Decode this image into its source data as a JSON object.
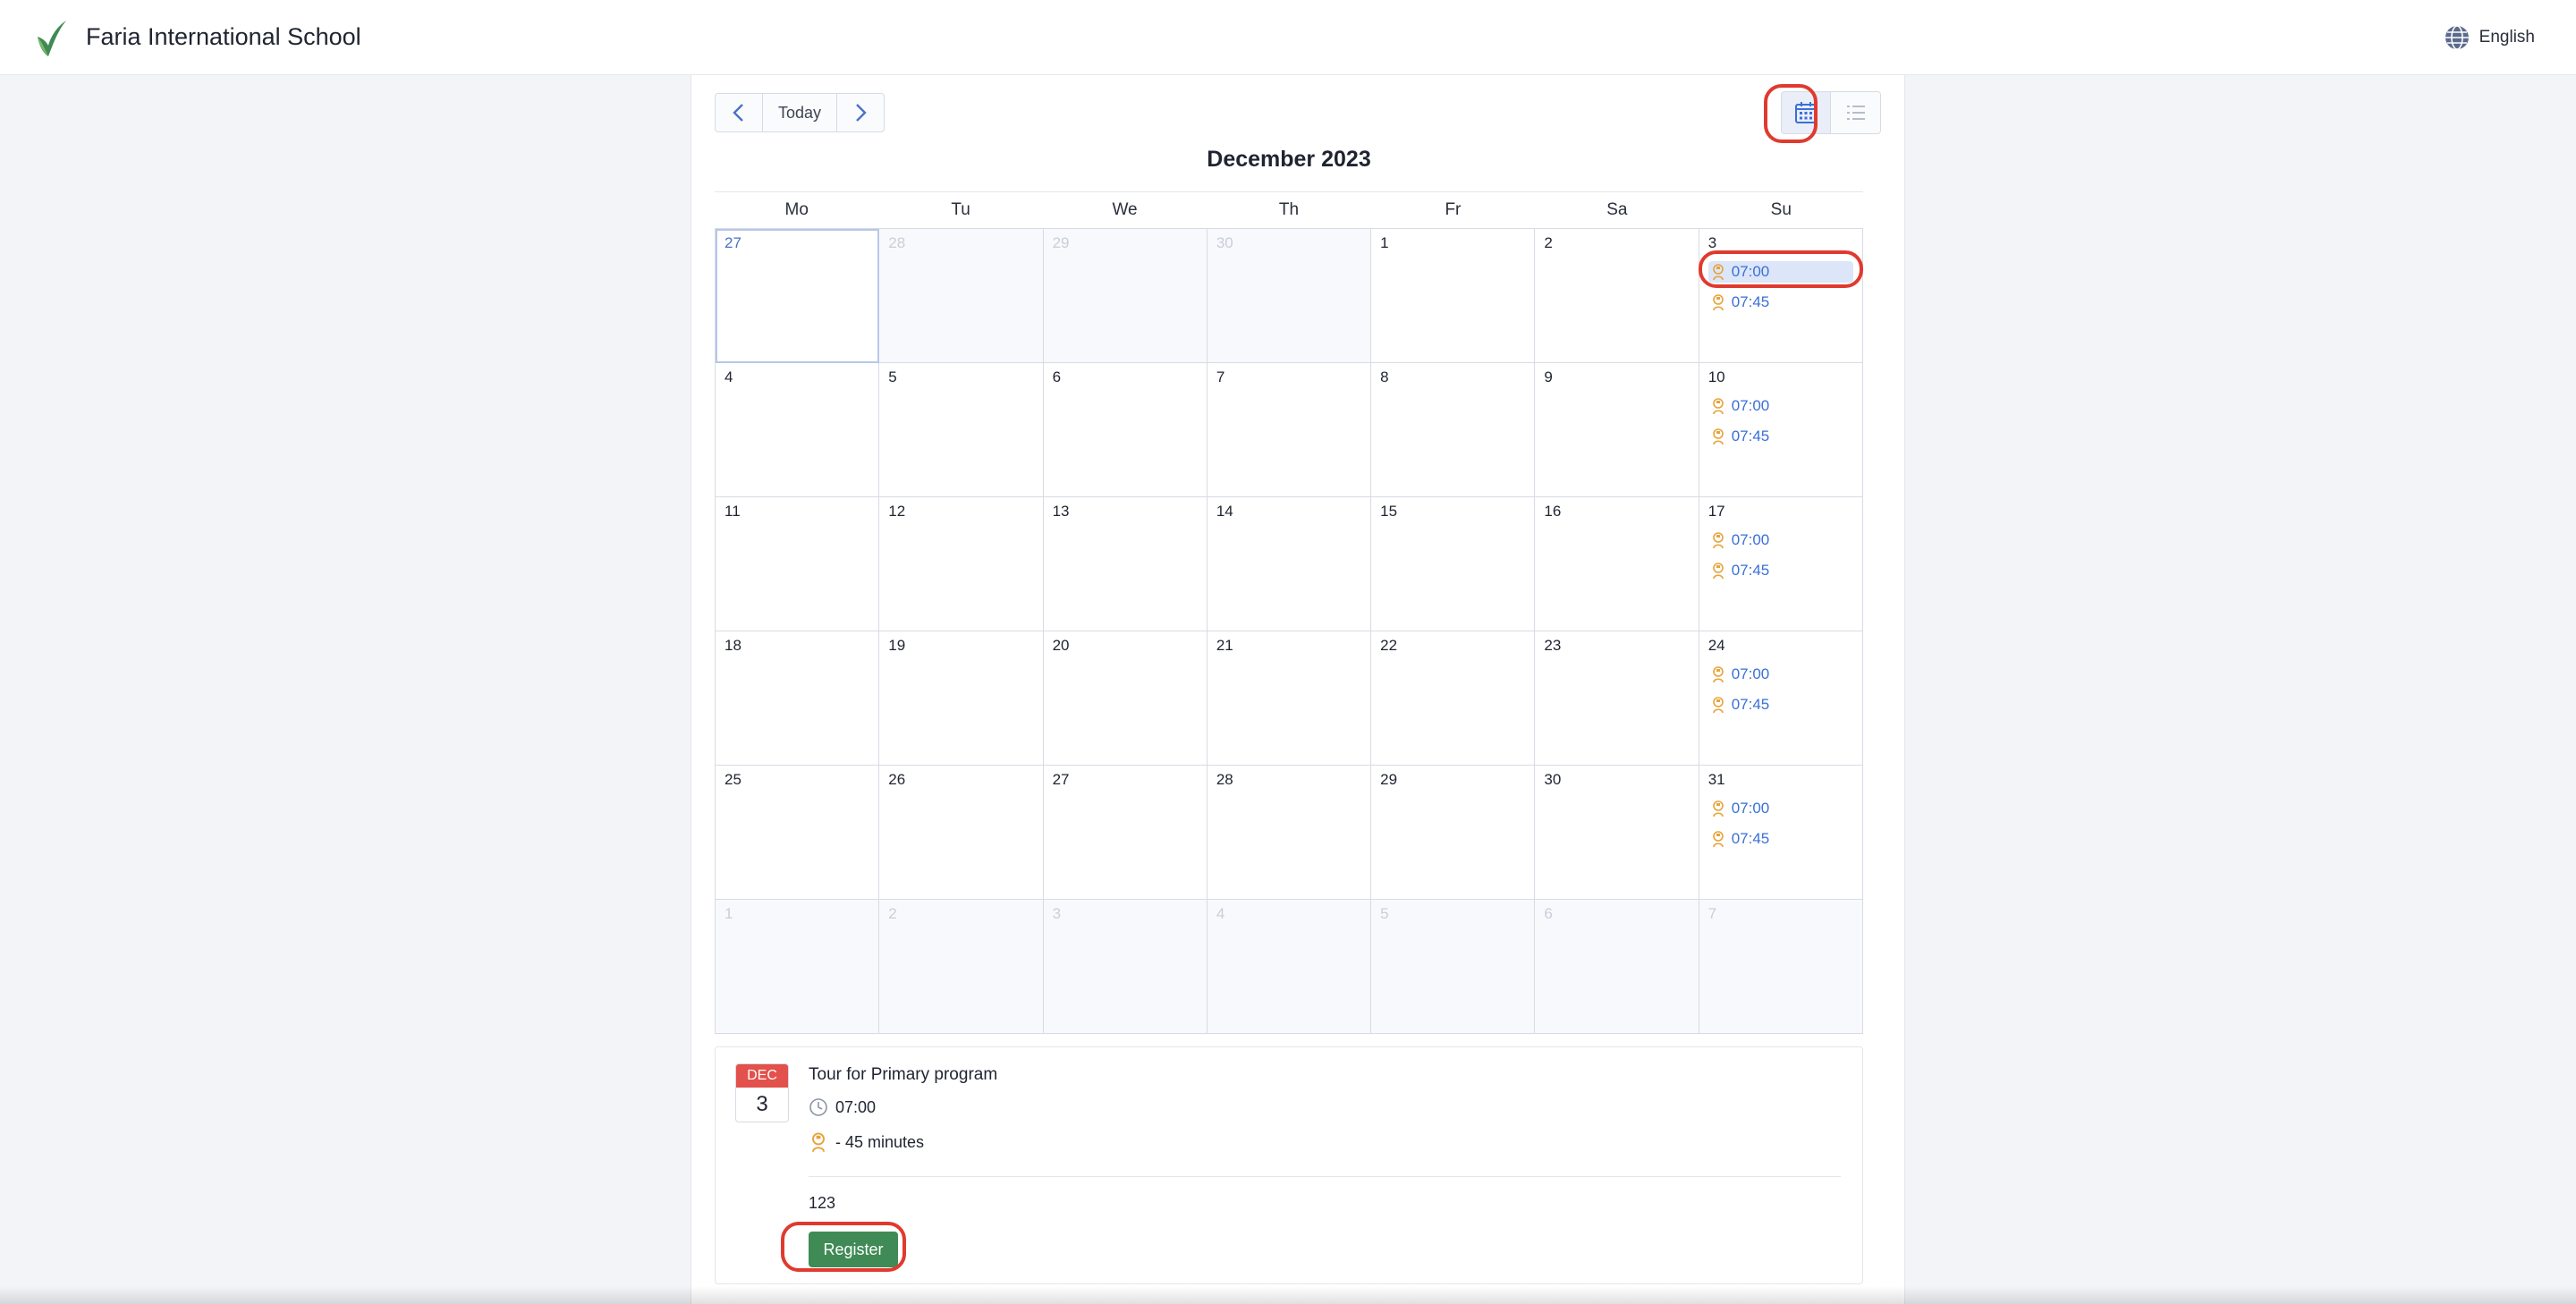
{
  "header": {
    "school_name": "Faria International School",
    "language": "English"
  },
  "toolbar": {
    "prev": "prev-icon",
    "today_label": "Today",
    "next": "next-icon"
  },
  "view": {
    "calendar_icon": "calendar-grid-icon",
    "list_icon": "list-icon",
    "active": "calendar"
  },
  "calendar": {
    "month_title": "December 2023",
    "weekdays": [
      "Mo",
      "Tu",
      "We",
      "Th",
      "Fr",
      "Sa",
      "Su"
    ],
    "weeks": [
      [
        {
          "day": "27",
          "other": false,
          "today": true,
          "events": []
        },
        {
          "day": "28",
          "other": true,
          "events": []
        },
        {
          "day": "29",
          "other": true,
          "events": []
        },
        {
          "day": "30",
          "other": true,
          "events": []
        },
        {
          "day": "1",
          "events": []
        },
        {
          "day": "2",
          "events": []
        },
        {
          "day": "3",
          "events": [
            {
              "time": "07:00",
              "selected": true
            },
            {
              "time": "07:45"
            }
          ]
        }
      ],
      [
        {
          "day": "4",
          "events": []
        },
        {
          "day": "5",
          "events": []
        },
        {
          "day": "6",
          "events": []
        },
        {
          "day": "7",
          "events": []
        },
        {
          "day": "8",
          "events": []
        },
        {
          "day": "9",
          "events": []
        },
        {
          "day": "10",
          "events": [
            {
              "time": "07:00"
            },
            {
              "time": "07:45"
            }
          ]
        }
      ],
      [
        {
          "day": "11",
          "events": []
        },
        {
          "day": "12",
          "events": []
        },
        {
          "day": "13",
          "events": []
        },
        {
          "day": "14",
          "events": []
        },
        {
          "day": "15",
          "events": []
        },
        {
          "day": "16",
          "events": []
        },
        {
          "day": "17",
          "events": [
            {
              "time": "07:00"
            },
            {
              "time": "07:45"
            }
          ]
        }
      ],
      [
        {
          "day": "18",
          "events": []
        },
        {
          "day": "19",
          "events": []
        },
        {
          "day": "20",
          "events": []
        },
        {
          "day": "21",
          "events": []
        },
        {
          "day": "22",
          "events": []
        },
        {
          "day": "23",
          "events": []
        },
        {
          "day": "24",
          "events": [
            {
              "time": "07:00"
            },
            {
              "time": "07:45"
            }
          ]
        }
      ],
      [
        {
          "day": "25",
          "events": []
        },
        {
          "day": "26",
          "events": []
        },
        {
          "day": "27",
          "events": []
        },
        {
          "day": "28",
          "events": []
        },
        {
          "day": "29",
          "events": []
        },
        {
          "day": "30",
          "events": []
        },
        {
          "day": "31",
          "events": [
            {
              "time": "07:00"
            },
            {
              "time": "07:45"
            }
          ]
        }
      ],
      [
        {
          "day": "1",
          "other": true,
          "events": []
        },
        {
          "day": "2",
          "other": true,
          "events": []
        },
        {
          "day": "3",
          "other": true,
          "events": []
        },
        {
          "day": "4",
          "other": true,
          "events": []
        },
        {
          "day": "5",
          "other": true,
          "events": []
        },
        {
          "day": "6",
          "other": true,
          "events": []
        },
        {
          "day": "7",
          "other": true,
          "events": []
        }
      ]
    ]
  },
  "details": {
    "month": "DEC",
    "day": "3",
    "title": "Tour for Primary program",
    "time": "07:00",
    "duration": "-  45 minutes",
    "description": "123",
    "register_label": "Register"
  },
  "colors": {
    "accent_blue": "#3a6fd8",
    "register_green": "#3f8a55",
    "badge_red": "#e2514b",
    "annotation_red": "#e03a2f"
  }
}
